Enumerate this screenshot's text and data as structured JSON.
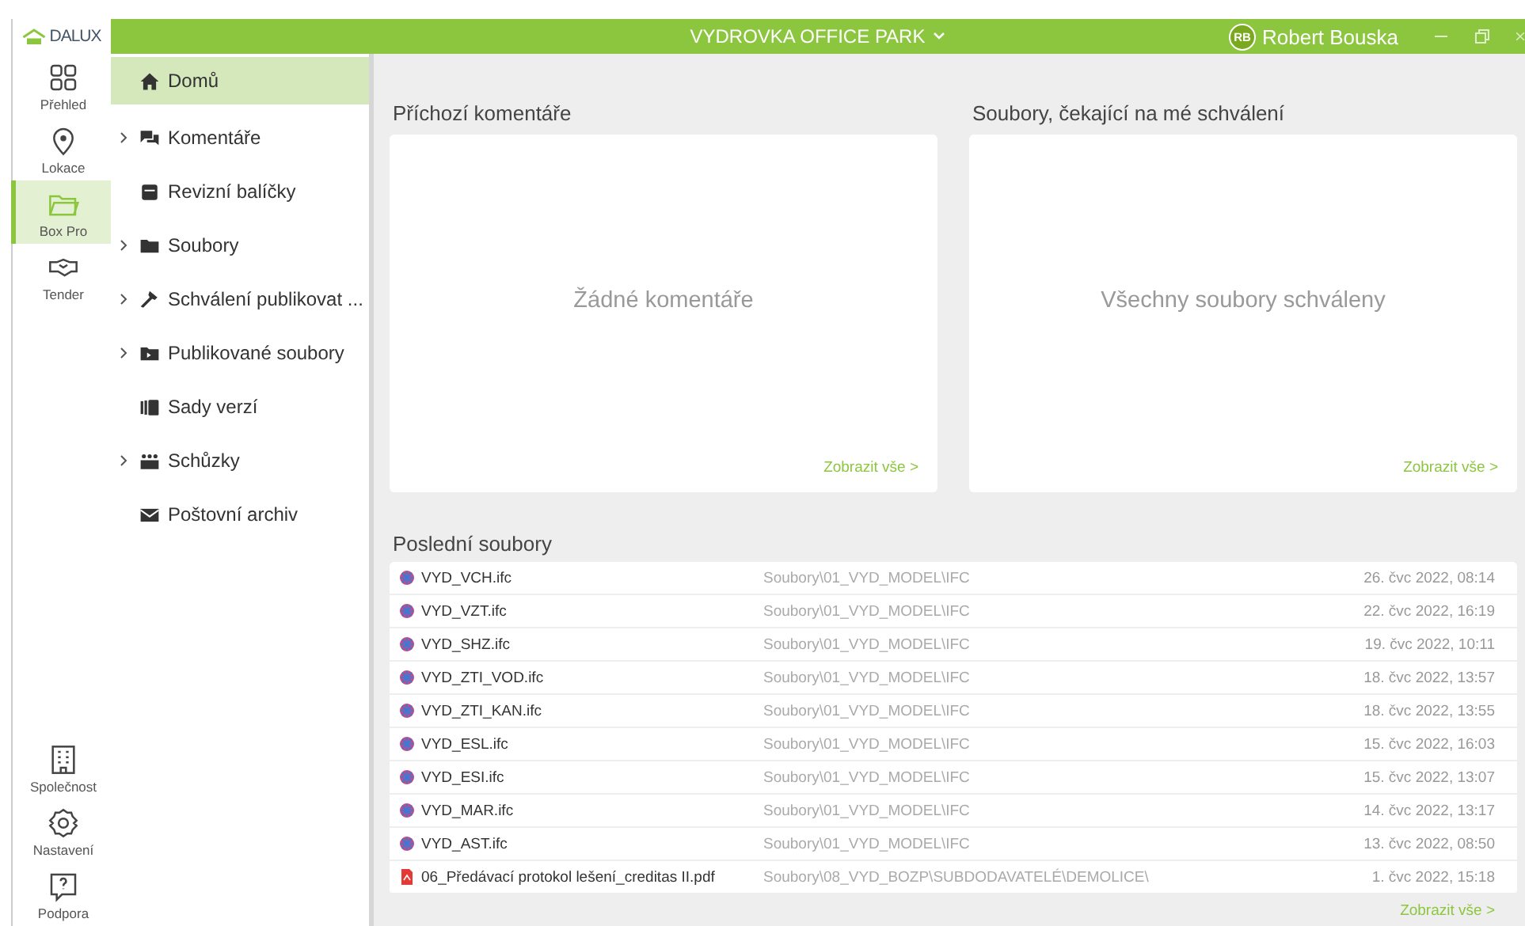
{
  "logo": {
    "text": "DALUX"
  },
  "rail": {
    "top": [
      {
        "label": "Přehled",
        "selected": false
      },
      {
        "label": "Lokace",
        "selected": false
      },
      {
        "label": "Box Pro",
        "selected": true
      },
      {
        "label": "Tender",
        "selected": false
      }
    ],
    "bottom": [
      {
        "label": "Společnost",
        "selected": false
      },
      {
        "label": "Nastavení",
        "selected": false
      },
      {
        "label": "Podpora",
        "selected": false
      }
    ]
  },
  "header": {
    "project": "VYDROVKA OFFICE PARK",
    "user": {
      "initials": "RB",
      "name": "Robert Bouska"
    }
  },
  "nav": [
    {
      "label": "Domů",
      "expandable": false,
      "selected": true
    },
    {
      "label": "Komentáře",
      "expandable": true,
      "selected": false
    },
    {
      "label": "Revizní balíčky",
      "expandable": false,
      "selected": false
    },
    {
      "label": "Soubory",
      "expandable": true,
      "selected": false
    },
    {
      "label": "Schválení publikovat ...",
      "expandable": true,
      "selected": false
    },
    {
      "label": "Publikované soubory",
      "expandable": true,
      "selected": false
    },
    {
      "label": "Sady verzí",
      "expandable": false,
      "selected": false
    },
    {
      "label": "Schůzky",
      "expandable": true,
      "selected": false
    },
    {
      "label": "Poštovní archiv",
      "expandable": false,
      "selected": false
    }
  ],
  "panels": [
    {
      "title": "Příchozí komentáře",
      "empty_text": "Žádné komentáře",
      "link": "Zobrazit vše >"
    },
    {
      "title": "Soubory, čekající na mé schválení",
      "empty_text": "Všechny soubory schváleny",
      "link": "Zobrazit vše >"
    }
  ],
  "recent_files": {
    "title": "Poslední soubory",
    "link": "Zobrazit vše >",
    "rows": [
      {
        "kind": "ifc",
        "name": "VYD_VCH.ifc",
        "path": "Soubory\\01_VYD_MODEL\\IFC",
        "date": "26. čvc 2022, 08:14"
      },
      {
        "kind": "ifc",
        "name": "VYD_VZT.ifc",
        "path": "Soubory\\01_VYD_MODEL\\IFC",
        "date": "22. čvc 2022, 16:19"
      },
      {
        "kind": "ifc",
        "name": "VYD_SHZ.ifc",
        "path": "Soubory\\01_VYD_MODEL\\IFC",
        "date": "19. čvc 2022, 10:11"
      },
      {
        "kind": "ifc",
        "name": "VYD_ZTI_VOD.ifc",
        "path": "Soubory\\01_VYD_MODEL\\IFC",
        "date": "18. čvc 2022, 13:57"
      },
      {
        "kind": "ifc",
        "name": "VYD_ZTI_KAN.ifc",
        "path": "Soubory\\01_VYD_MODEL\\IFC",
        "date": "18. čvc 2022, 13:55"
      },
      {
        "kind": "ifc",
        "name": "VYD_ESL.ifc",
        "path": "Soubory\\01_VYD_MODEL\\IFC",
        "date": "15. čvc 2022, 16:03"
      },
      {
        "kind": "ifc",
        "name": "VYD_ESI.ifc",
        "path": "Soubory\\01_VYD_MODEL\\IFC",
        "date": "15. čvc 2022, 13:07"
      },
      {
        "kind": "ifc",
        "name": "VYD_MAR.ifc",
        "path": "Soubory\\01_VYD_MODEL\\IFC",
        "date": "14. čvc 2022, 13:17"
      },
      {
        "kind": "ifc",
        "name": "VYD_AST.ifc",
        "path": "Soubory\\01_VYD_MODEL\\IFC",
        "date": "13. čvc 2022, 08:50"
      },
      {
        "kind": "pdf",
        "name": "06_Předávací protokol lešení_creditas II.pdf",
        "path": "Soubory\\08_VYD_BOZP\\SUBDODAVATELÉ\\DEMOLICE\\",
        "date": "1. čvc 2022, 15:18"
      }
    ]
  }
}
